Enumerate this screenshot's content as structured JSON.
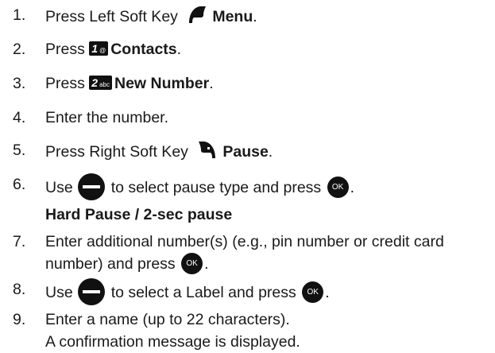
{
  "steps": [
    {
      "num": "1.",
      "before": "Press Left Soft Key",
      "bold": "Menu",
      "after": "."
    },
    {
      "num": "2.",
      "before": "Press",
      "key": "1",
      "key_sub": "@",
      "bold": "Contacts",
      "after": "."
    },
    {
      "num": "3.",
      "before": "Press",
      "key": "2",
      "key_sub": "abc",
      "bold": "New Number",
      "after": "."
    },
    {
      "num": "4.",
      "text": "Enter the number."
    },
    {
      "num": "5.",
      "before": "Press Right Soft Key",
      "bold": "Pause",
      "after": "."
    },
    {
      "num": "6.",
      "before": "Use",
      "middle": "to select pause type and press",
      "ok": "OK",
      "after": ".",
      "line2": "Hard Pause / 2-sec pause"
    },
    {
      "num": "7.",
      "text": "Enter additional number(s) (e.g., pin number or credit card",
      "line2_before": "number) and press",
      "ok": "OK",
      "after": "."
    },
    {
      "num": "8.",
      "before": "Use",
      "middle": "to select a Label and press",
      "ok": "OK",
      "after": "."
    },
    {
      "num": "9.",
      "text": "Enter a name (up to 22 characters).",
      "line2": "A confirmation message is displayed."
    }
  ]
}
